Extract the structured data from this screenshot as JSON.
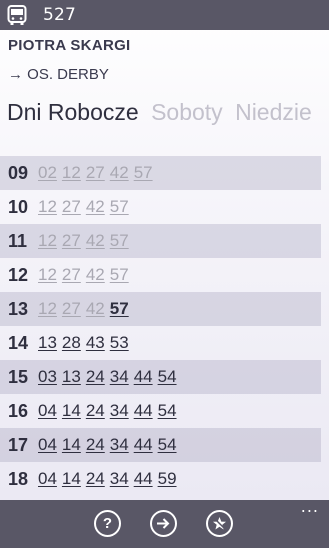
{
  "header": {
    "icon": "bus-icon",
    "route_number": "527"
  },
  "stop": {
    "name": "PIOTRA SKARGI",
    "direction": "→ OS. DERBY"
  },
  "tabs": [
    {
      "label": "Dni Robocze",
      "active": true
    },
    {
      "label": "Soboty",
      "active": false
    },
    {
      "label": "Niedzie",
      "active": false
    }
  ],
  "timetable": [
    {
      "hour": "09",
      "minutes": [
        "02",
        "12",
        "27",
        "42",
        "57"
      ],
      "state": [
        "past",
        "past",
        "past",
        "past",
        "past"
      ]
    },
    {
      "hour": "10",
      "minutes": [
        "12",
        "27",
        "42",
        "57"
      ],
      "state": [
        "past",
        "past",
        "past",
        "past"
      ]
    },
    {
      "hour": "11",
      "minutes": [
        "12",
        "27",
        "42",
        "57"
      ],
      "state": [
        "past",
        "past",
        "past",
        "past"
      ]
    },
    {
      "hour": "12",
      "minutes": [
        "12",
        "27",
        "42",
        "57"
      ],
      "state": [
        "past",
        "past",
        "past",
        "past"
      ]
    },
    {
      "hour": "13",
      "minutes": [
        "12",
        "27",
        "42",
        "57"
      ],
      "state": [
        "past",
        "past",
        "past",
        "next"
      ]
    },
    {
      "hour": "14",
      "minutes": [
        "13",
        "28",
        "43",
        "53"
      ],
      "state": [
        "future",
        "future",
        "future",
        "future"
      ]
    },
    {
      "hour": "15",
      "minutes": [
        "03",
        "13",
        "24",
        "34",
        "44",
        "54"
      ],
      "state": [
        "future",
        "future",
        "future",
        "future",
        "future",
        "future"
      ]
    },
    {
      "hour": "16",
      "minutes": [
        "04",
        "14",
        "24",
        "34",
        "44",
        "54"
      ],
      "state": [
        "future",
        "future",
        "future",
        "future",
        "future",
        "future"
      ]
    },
    {
      "hour": "17",
      "minutes": [
        "04",
        "14",
        "24",
        "34",
        "44",
        "54"
      ],
      "state": [
        "future",
        "future",
        "future",
        "future",
        "future",
        "future"
      ]
    },
    {
      "hour": "18",
      "minutes": [
        "04",
        "14",
        "24",
        "34",
        "44",
        "59"
      ],
      "state": [
        "future",
        "future",
        "future",
        "future",
        "future",
        "future"
      ]
    }
  ],
  "appbar": {
    "buttons": [
      {
        "name": "help-button",
        "icon": "question-icon"
      },
      {
        "name": "next-button",
        "icon": "arrow-right-icon"
      },
      {
        "name": "favorite-button",
        "icon": "star-add-icon"
      }
    ],
    "more_label": "..."
  },
  "colors": {
    "bar": "#595766",
    "past": "#a9a8b2",
    "text": "#2f2f3f",
    "row_shade": "#dcdae6"
  }
}
